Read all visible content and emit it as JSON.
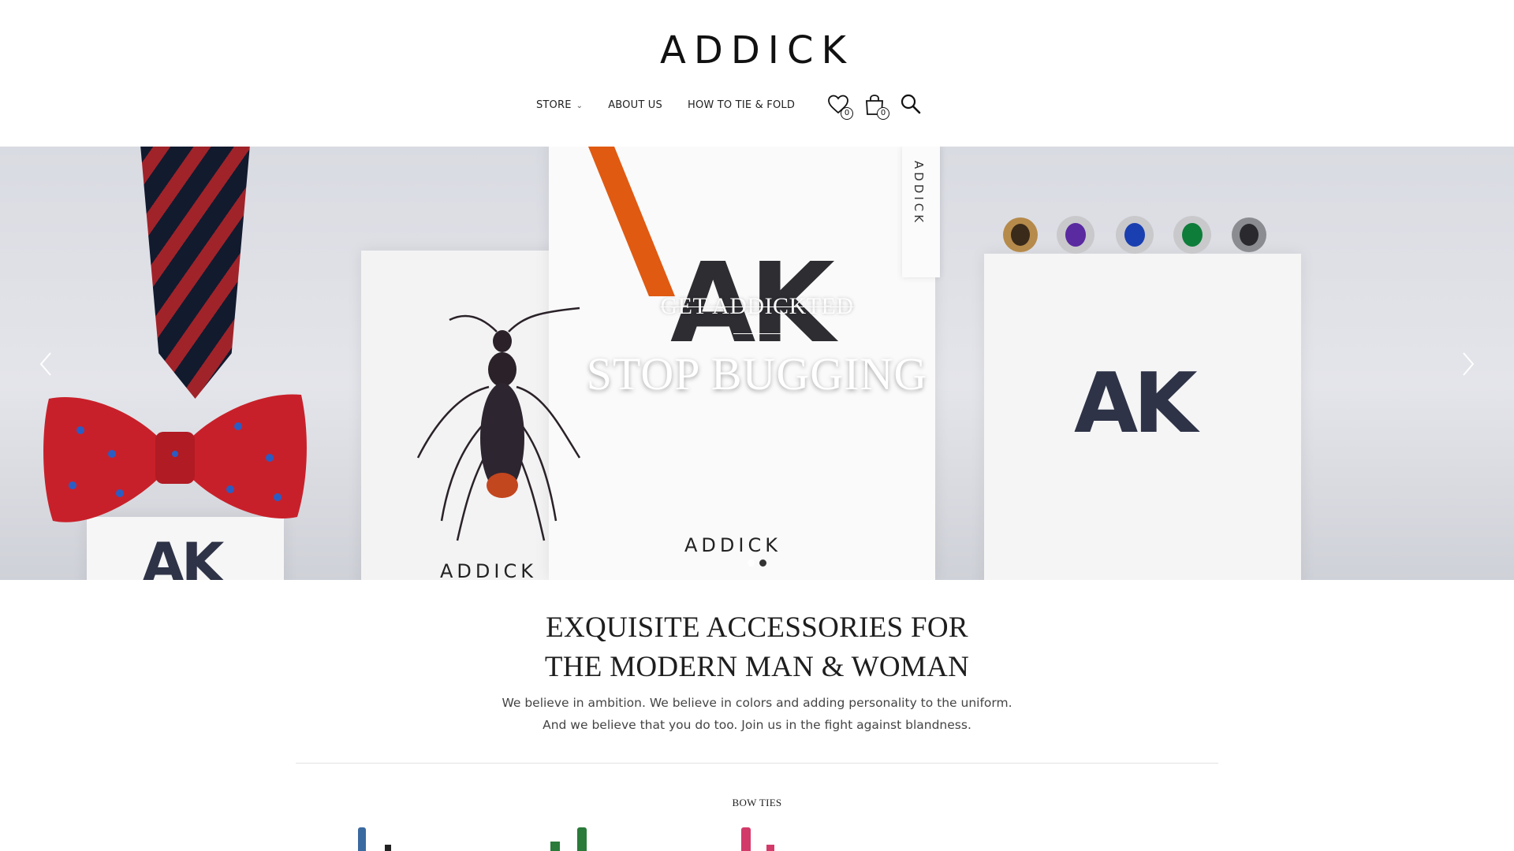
{
  "header": {
    "logo": "ADDICK",
    "nav": [
      {
        "label": "STORE",
        "has_dropdown": true
      },
      {
        "label": "ABOUT US"
      },
      {
        "label": "HOW TO TIE & FOLD"
      }
    ],
    "wishlist_count": "0",
    "cart_count": "0",
    "icons": [
      "wishlist-heart-icon",
      "shopping-bag-icon",
      "search-icon"
    ]
  },
  "hero": {
    "subtitle": "GET ADDICKTED",
    "title": "STOP BUGGING",
    "box_brand": "ADDICK",
    "box_mark": "AK",
    "tag_text": "ADDICK",
    "slides": 2,
    "active_slide": 2,
    "colors": {
      "tie_navy": "#121a2e",
      "tie_red": "#a0232a",
      "ribbon": "#e05a12",
      "bowtie": "#c8202a"
    }
  },
  "intro": {
    "title_line1": "EXQUISITE ACCESSORIES FOR",
    "title_line2": "THE MODERN MAN & WOMAN",
    "text_line1": "We believe in ambition. We believe in colors and adding personality to the uniform.",
    "text_line2": "And we believe that you do too. Join us in the fight against blandness."
  },
  "section": {
    "label": "BOW TIES"
  }
}
